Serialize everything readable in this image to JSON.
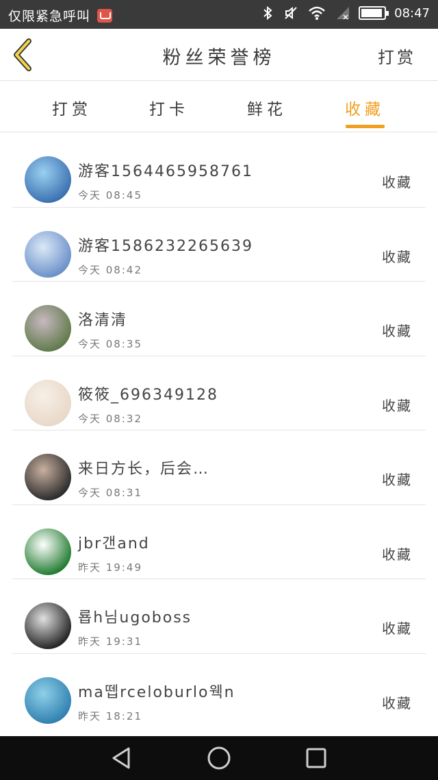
{
  "status_bar": {
    "carrier_text": "仅限紧急呼叫",
    "time": "08:47",
    "icons": [
      "mail-icon",
      "bluetooth-icon",
      "mute-icon",
      "wifi-icon",
      "signal-icon",
      "battery-icon"
    ]
  },
  "header": {
    "back_icon": "chevron-left-icon",
    "title": "粉丝荣誉榜",
    "action_label": "打赏"
  },
  "tabs": [
    {
      "label": "打赏",
      "active": false
    },
    {
      "label": "打卡",
      "active": false
    },
    {
      "label": "鲜花",
      "active": false
    },
    {
      "label": "收藏",
      "active": true
    }
  ],
  "accent_color": "#f0a020",
  "fans": [
    {
      "name": "游客1564465958761",
      "time": "今天 08:45",
      "kind": "收藏",
      "avatar_colors": [
        "#3a6fb0",
        "#9ad0f0"
      ]
    },
    {
      "name": "游客1586232265639",
      "time": "今天 08:42",
      "kind": "收藏",
      "avatar_colors": [
        "#6a8fc8",
        "#dbe9f7"
      ]
    },
    {
      "name": "洛清清",
      "time": "今天 08:35",
      "kind": "收藏",
      "avatar_colors": [
        "#5f7a4a",
        "#c8b8c0"
      ]
    },
    {
      "name": "筱筱_696349128",
      "time": "今天 08:32",
      "kind": "收藏",
      "avatar_colors": [
        "#e8d8c8",
        "#f7efe6"
      ]
    },
    {
      "name": "来日方长，后会…",
      "time": "今天 08:31",
      "kind": "收藏",
      "avatar_colors": [
        "#2a2a2a",
        "#c9b0a0"
      ]
    },
    {
      "name": "jbr갠and",
      "time": "昨天 19:49",
      "kind": "收藏",
      "avatar_colors": [
        "#1f7a2e",
        "#ffffff"
      ]
    },
    {
      "name": "룝h님ugoboss",
      "time": "昨天 19:31",
      "kind": "收藏",
      "avatar_colors": [
        "#222222",
        "#e0e0e0"
      ]
    },
    {
      "name": "ma뗍rceloburlo웩n",
      "time": "昨天 18:21",
      "kind": "收藏",
      "avatar_colors": [
        "#2f7fb0",
        "#8fd0e8"
      ]
    }
  ],
  "nav_bar": {
    "icons": [
      "back-triangle-icon",
      "home-circle-icon",
      "recents-square-icon"
    ]
  }
}
